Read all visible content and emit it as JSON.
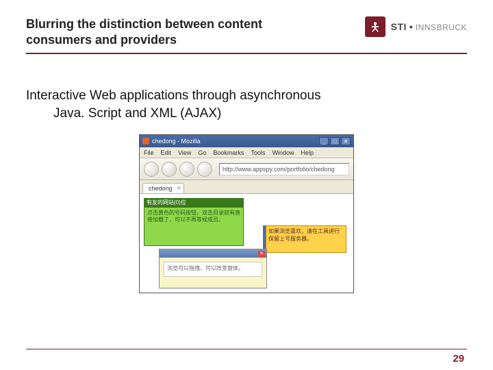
{
  "header": {
    "title": "Blurring the distinction between content consumers and providers",
    "logo": {
      "sti": "STI",
      "dot": "•",
      "city": "INNSBRUCK"
    }
  },
  "body": {
    "line1": "Interactive Web applications through asynchronous",
    "line2": "Java. Script and XML (AJAX)"
  },
  "browser": {
    "window_title": "chedong - Mozilla",
    "menu": {
      "file": "File",
      "edit": "Edit",
      "view": "View",
      "go": "Go",
      "bookmarks": "Bookmarks",
      "tools": "Tools",
      "window": "Window",
      "help": "Help"
    },
    "address": "http://www.appspy.com/portfolio/chedong",
    "tab_label": "chedong",
    "green_header": "有友的网站(0)位",
    "green_text": "点击黄色的号码按钮，双击目录就有直接加载了，可以不再等候成员。",
    "yellow_text": "如果浏览喜欢，请在工具进行保留上号服务器。",
    "dialog_text": "浏览可以拖拽，可以改变窗体。"
  },
  "footer": {
    "page": "29"
  }
}
